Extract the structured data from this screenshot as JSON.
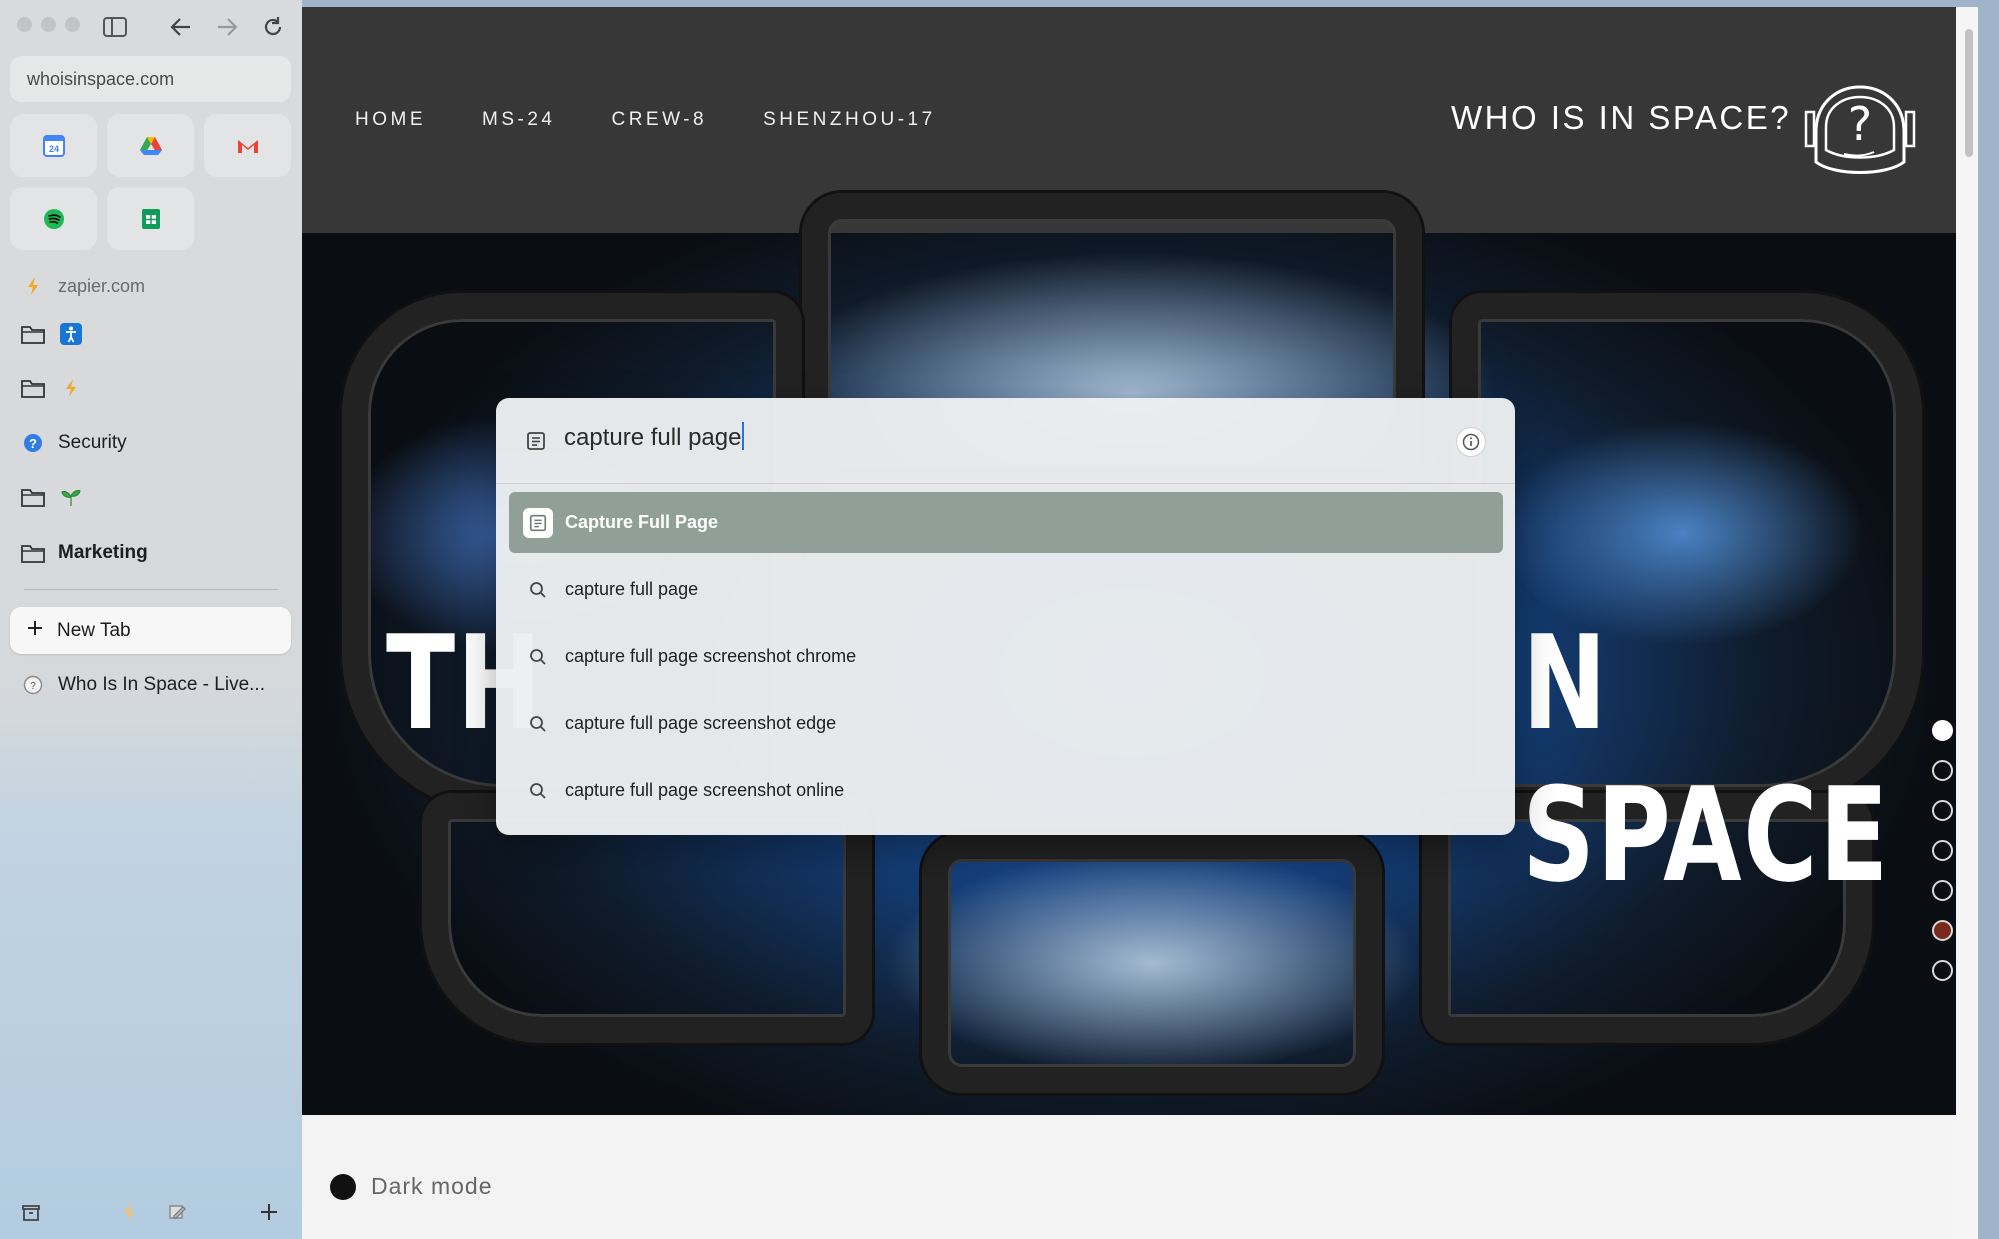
{
  "browser": {
    "url": "whoisinspace.com",
    "favorites": [
      {
        "icon": "google-calendar-icon",
        "label": "24"
      },
      {
        "icon": "google-drive-icon"
      },
      {
        "icon": "gmail-icon"
      },
      {
        "icon": "spotify-icon"
      },
      {
        "icon": "google-sheets-icon"
      }
    ],
    "sidebar_items": [
      {
        "label": "zapier.com",
        "icon": "zapier-bolt-icon"
      },
      {
        "label": "",
        "icon": "folder-icon"
      },
      {
        "label": "",
        "icon": "folder-icon"
      },
      {
        "label": "Security",
        "icon": "question-circle-icon"
      },
      {
        "label": "",
        "icon": "folder-icon"
      },
      {
        "label": "Marketing",
        "icon": "folder-icon"
      }
    ],
    "new_tab_label": "New Tab",
    "open_tab_label": "Who Is In Space - Live..."
  },
  "site": {
    "nav": [
      "HOME",
      "MS-24",
      "CREW-8",
      "SHENZHOU-17"
    ],
    "brand": "WHO IS IN SPACE?",
    "hero_left": "TH",
    "hero_right": "N SPACE",
    "slider": {
      "count": 7,
      "active_index": 0,
      "highlight_index": 5
    },
    "dark_mode_label": "Dark mode"
  },
  "palette": {
    "query": "capture full page",
    "results": [
      {
        "label": "Capture Full Page",
        "type": "command",
        "icon": "capture-page-icon",
        "selected": true
      },
      {
        "label": "capture full page",
        "type": "search",
        "icon": "search-icon"
      },
      {
        "label": "capture full page screenshot chrome",
        "type": "search",
        "icon": "search-icon"
      },
      {
        "label": "capture full page screenshot edge",
        "type": "search",
        "icon": "search-icon"
      },
      {
        "label": "capture full page screenshot online",
        "type": "search",
        "icon": "search-icon"
      }
    ]
  },
  "colors": {
    "header_bg": "#373737",
    "selected_result_bg": "#909f97",
    "caret": "#2f6fe0"
  }
}
